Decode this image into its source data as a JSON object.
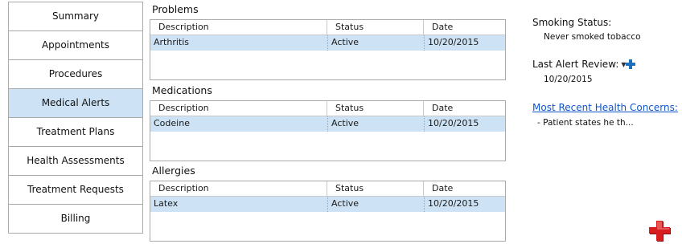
{
  "nav": {
    "items": [
      {
        "label": "Summary"
      },
      {
        "label": "Appointments"
      },
      {
        "label": "Procedures"
      },
      {
        "label": "Medical Alerts"
      },
      {
        "label": "Treatment Plans"
      },
      {
        "label": "Health Assessments"
      },
      {
        "label": "Treatment Requests"
      },
      {
        "label": "Billing"
      }
    ],
    "active_item": "Medical Alerts"
  },
  "columns": {
    "description": "Description",
    "status": "Status",
    "date": "Date"
  },
  "problems": {
    "title": "Problems",
    "rows": [
      {
        "description": "Arthritis",
        "status": "Active",
        "date": "10/20/2015"
      }
    ]
  },
  "medications": {
    "title": "Medications",
    "rows": [
      {
        "description": "Codeine",
        "status": "Active",
        "date": "10/20/2015"
      }
    ]
  },
  "allergies": {
    "title": "Allergies",
    "rows": [
      {
        "description": "Latex",
        "status": "Active",
        "date": "10/20/2015"
      }
    ]
  },
  "info": {
    "smoking_label": "Smoking Status:",
    "smoking_value": "Never smoked tobacco",
    "alert_review_label": "Last Alert Review:",
    "alert_review_value": "10/20/2015",
    "health_concerns_link": "Most Recent Health Concerns:",
    "health_concern_item": "- Patient states he th..."
  },
  "icons": {
    "add": "plus-icon",
    "dropdown": "chevron-down-icon",
    "medical_alert": "medical-cross-icon"
  },
  "colors": {
    "selected_row": "#cde3f5",
    "link": "#1155cc",
    "plus": "#1f6fbf",
    "medical_cross": "#d81e1e"
  }
}
